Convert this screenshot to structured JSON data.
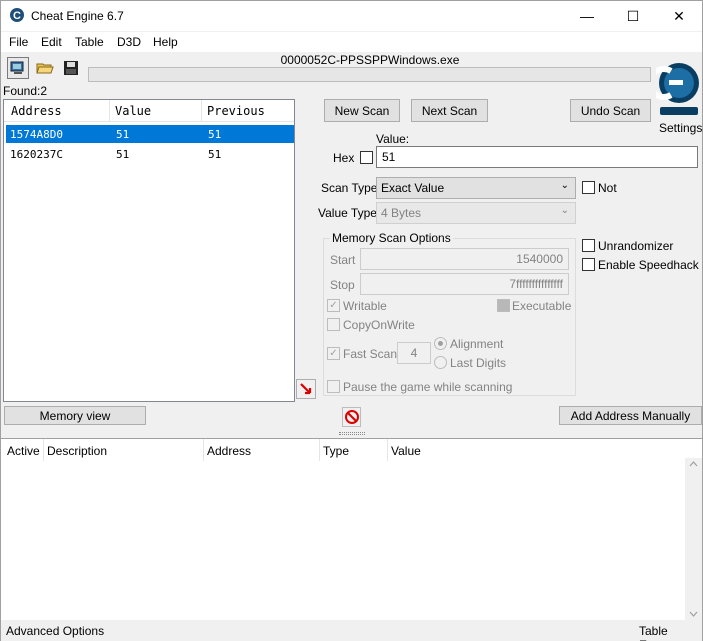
{
  "window": {
    "title": "Cheat Engine 6.7",
    "minimize": "—",
    "maximize": "☐",
    "close": "✕"
  },
  "menu": {
    "file": "File",
    "edit": "Edit",
    "table": "Table",
    "d3d": "D3D",
    "help": "Help"
  },
  "process_title": "0000052C-PPSSPPWindows.exe",
  "settings_label": "Settings",
  "found_label": "Found:2",
  "results": {
    "columns": [
      "Address",
      "Value",
      "Previous"
    ],
    "rows": [
      {
        "address": "1574A8D0",
        "value": "51",
        "previous": "51"
      },
      {
        "address": "1620237C",
        "value": "51",
        "previous": "51"
      }
    ]
  },
  "scan": {
    "new_scan": "New Scan",
    "next_scan": "Next Scan",
    "undo_scan": "Undo Scan",
    "value_label": "Value:",
    "hex_label": "Hex",
    "value": "51",
    "scan_type_label": "Scan Type",
    "scan_type": "Exact Value",
    "not_label": "Not",
    "value_type_label": "Value Type",
    "value_type": "4 Bytes"
  },
  "memory_options": {
    "title": "Memory Scan Options",
    "start_label": "Start",
    "start": "1540000",
    "stop_label": "Stop",
    "stop": "7fffffffffffffff",
    "writable": "Writable",
    "executable": "Executable",
    "copy_on_write": "CopyOnWrite",
    "fast_scan": "Fast Scan",
    "fast_scan_value": "4",
    "alignment": "Alignment",
    "last_digits": "Last Digits",
    "pause_game": "Pause the game while scanning"
  },
  "extras": {
    "unrandomizer": "Unrandomizer",
    "enable_speedhack": "Enable Speedhack"
  },
  "memory_view": "Memory view",
  "add_address_manually": "Add Address Manually",
  "address_table": {
    "columns": [
      "Active",
      "Description",
      "Address",
      "Type",
      "Value"
    ]
  },
  "status": {
    "advanced_options": "Advanced Options",
    "table_extras": "Table Extras"
  },
  "colors": {
    "selection": "#0078d7",
    "window_bg": "#f0f0f0"
  }
}
